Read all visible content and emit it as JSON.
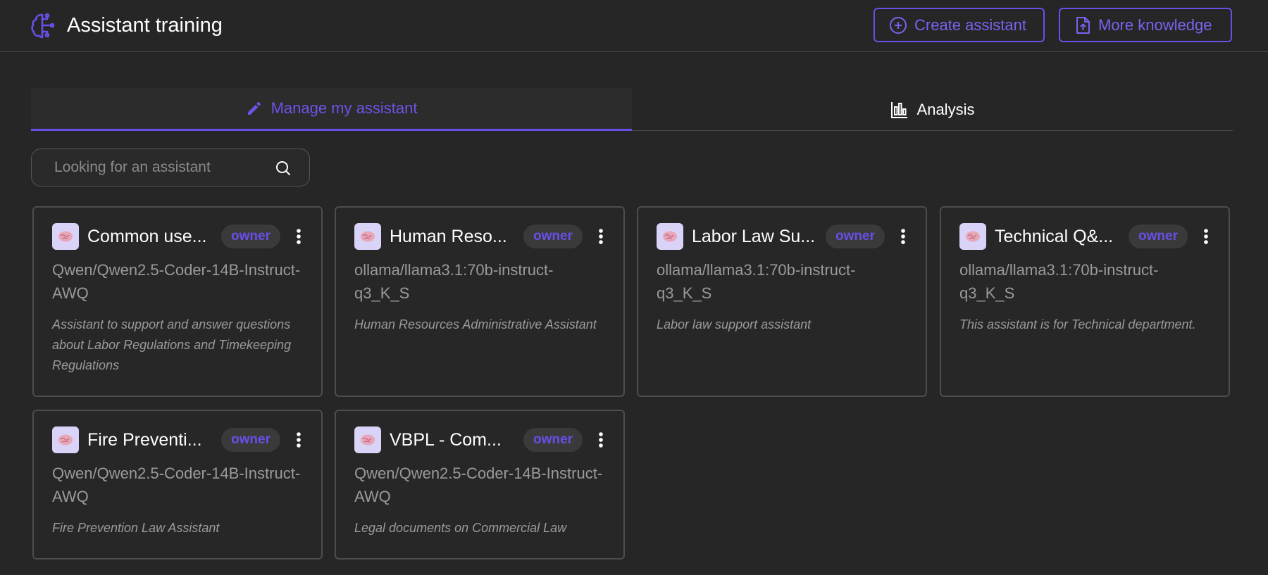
{
  "header": {
    "title": "Assistant training",
    "create_label": "Create assistant",
    "more_label": "More knowledge",
    "accent": "#6a4ee8"
  },
  "tabs": [
    {
      "label": "Manage my assistant",
      "icon": "pencil-icon",
      "active": true
    },
    {
      "label": "Analysis",
      "icon": "bar-chart-icon",
      "active": false
    }
  ],
  "search": {
    "placeholder": "Looking for an assistant"
  },
  "cards": [
    {
      "title": "Common use...",
      "badge": "owner",
      "model": "Qwen/Qwen2.5-Coder-14B-Instruct-AWQ",
      "description": "Assistant to support and answer questions about Labor Regulations and Timekeeping Regulations"
    },
    {
      "title": "Human Reso...",
      "badge": "owner",
      "model": "ollama/llama3.1:70b-instruct-q3_K_S",
      "description": "Human Resources Administrative Assistant"
    },
    {
      "title": "Labor Law Su...",
      "badge": "owner",
      "model": "ollama/llama3.1:70b-instruct-q3_K_S",
      "description": "Labor law support assistant"
    },
    {
      "title": "Technical Q&...",
      "badge": "owner",
      "model": "ollama/llama3.1:70b-instruct-q3_K_S",
      "description": "This assistant is for Technical department."
    },
    {
      "title": "Fire Preventi...",
      "badge": "owner",
      "model": "Qwen/Qwen2.5-Coder-14B-Instruct-AWQ",
      "description": "Fire Prevention Law Assistant"
    },
    {
      "title": "VBPL - Com...",
      "badge": "owner",
      "model": "Qwen/Qwen2.5-Coder-14B-Instruct-AWQ",
      "description": "Legal documents on Commercial Law"
    }
  ]
}
